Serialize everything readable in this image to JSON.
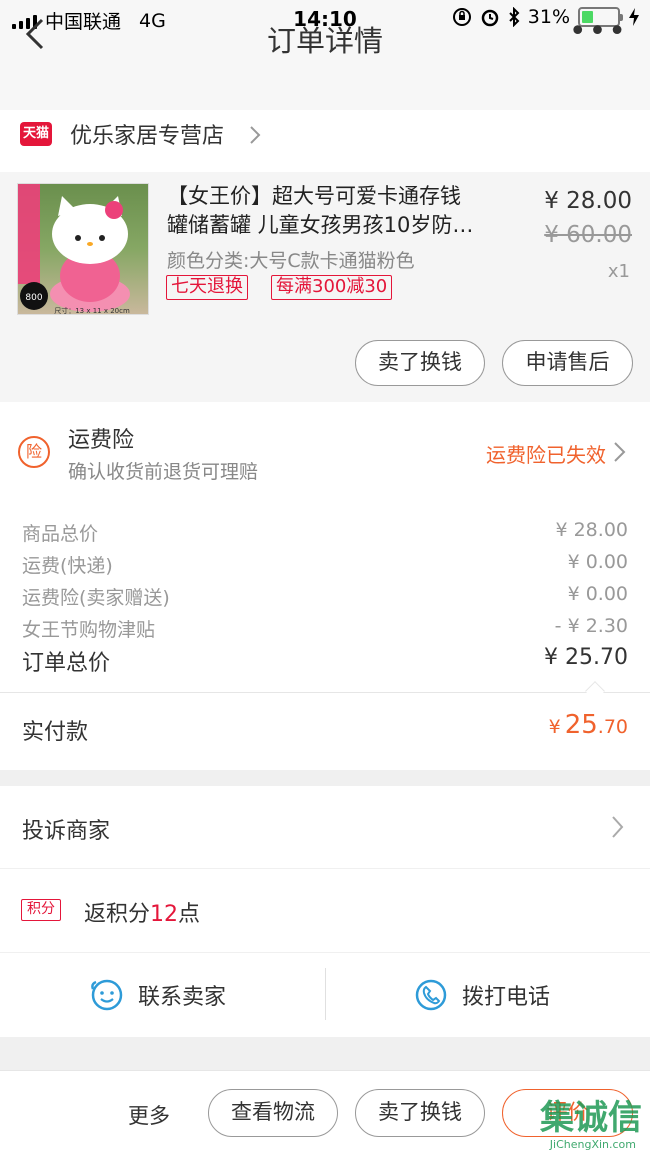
{
  "status_bar": {
    "carrier": "中国联通",
    "network": "4G",
    "time": "14:10",
    "battery": "31%",
    "battery_level": 0.31
  },
  "nav": {
    "title": "订单详情",
    "more": "•••"
  },
  "store": {
    "badge": "天猫",
    "name": "优乐家居专营店"
  },
  "product": {
    "title_line1": "【女王价】超大号可爱卡通存钱",
    "title_line2": "罐储蓄罐 儿童女孩男孩10岁防…",
    "spec": "颜色分类:大号C款卡通猫粉色",
    "tags": [
      "七天退换",
      "每满300减30"
    ],
    "price": "¥ 28.00",
    "original_price": "¥ 60.00",
    "quantity": "x1",
    "thumb_badge": "800",
    "thumb_caption": "尺寸：13 x 11 x 20cm",
    "actions": [
      "卖了换钱",
      "申请售后"
    ]
  },
  "insurance": {
    "icon": "险",
    "title": "运费险",
    "subtitle": "确认收货前退货可理赔",
    "status": "运费险已失效"
  },
  "price_details": [
    {
      "label": "商品总价",
      "value": "¥ 28.00"
    },
    {
      "label": "运费(快递)",
      "value": "¥ 0.00"
    },
    {
      "label": "运费险(卖家赠送)",
      "value": "¥ 0.00"
    },
    {
      "label": "女王节购物津贴",
      "value": "- ¥ 2.30"
    }
  ],
  "total": {
    "label": "订单总价",
    "value": "¥ 25.70"
  },
  "paid": {
    "label": "实付款",
    "currency": "¥",
    "integer": "25",
    "decimal": ".70"
  },
  "complaint": {
    "label": "投诉商家"
  },
  "points": {
    "badge": "积分",
    "prefix": "返积分",
    "count": "12",
    "suffix": "点"
  },
  "contact": {
    "seller": "联系卖家",
    "phone": "拨打电话"
  },
  "bottom_bar": {
    "more": "更多",
    "logistics": "查看物流",
    "sell": "卖了换钱",
    "rate": "评价"
  },
  "watermark": {
    "text": "集诚信",
    "sub": "JiChengXin.com"
  },
  "colors": {
    "accent": "#f0622d",
    "tmall": "#e4163a",
    "contact": "#2e9bd8"
  }
}
